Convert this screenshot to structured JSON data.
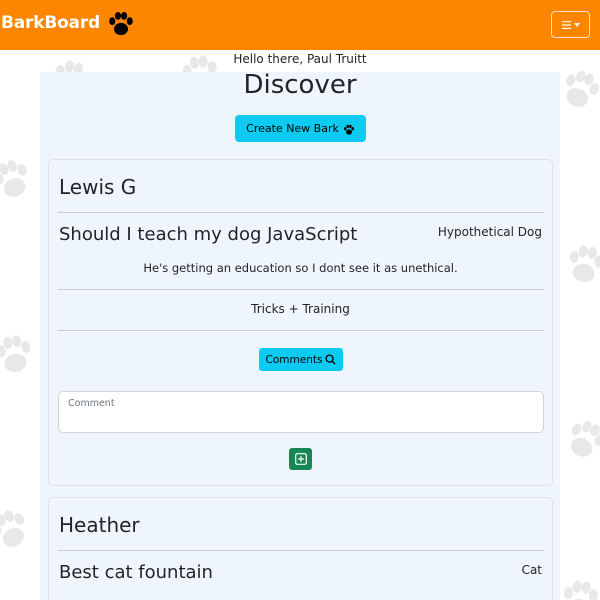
{
  "navbar": {
    "brand": "BarkBoard",
    "brand_icon": "paw-icon",
    "menu_icon": "hamburger-icon",
    "brand_color": "#fd8500"
  },
  "greeting": "Hello there, Paul Truitt",
  "page_title": "Discover",
  "create_button": {
    "label": "Create New Bark",
    "icon": "paw-icon",
    "color": "#0dcaf0"
  },
  "posts": [
    {
      "author": "Lewis G",
      "title": "Should I teach my dog JavaScript",
      "dog": "Hypothetical Dog",
      "body": "He's getting an education so I dont see it as unethical.",
      "category": "Tricks + Training",
      "comments_label": "Comments",
      "comments_icon": "search-icon",
      "comment_placeholder": "Comment",
      "add_icon": "plus-square-icon"
    },
    {
      "author": "Heather",
      "title": "Best cat fountain",
      "dog": "Cat"
    }
  ],
  "colors": {
    "accent": "#0dcaf0",
    "success": "#198754",
    "card_bg": "#eef5fd"
  }
}
